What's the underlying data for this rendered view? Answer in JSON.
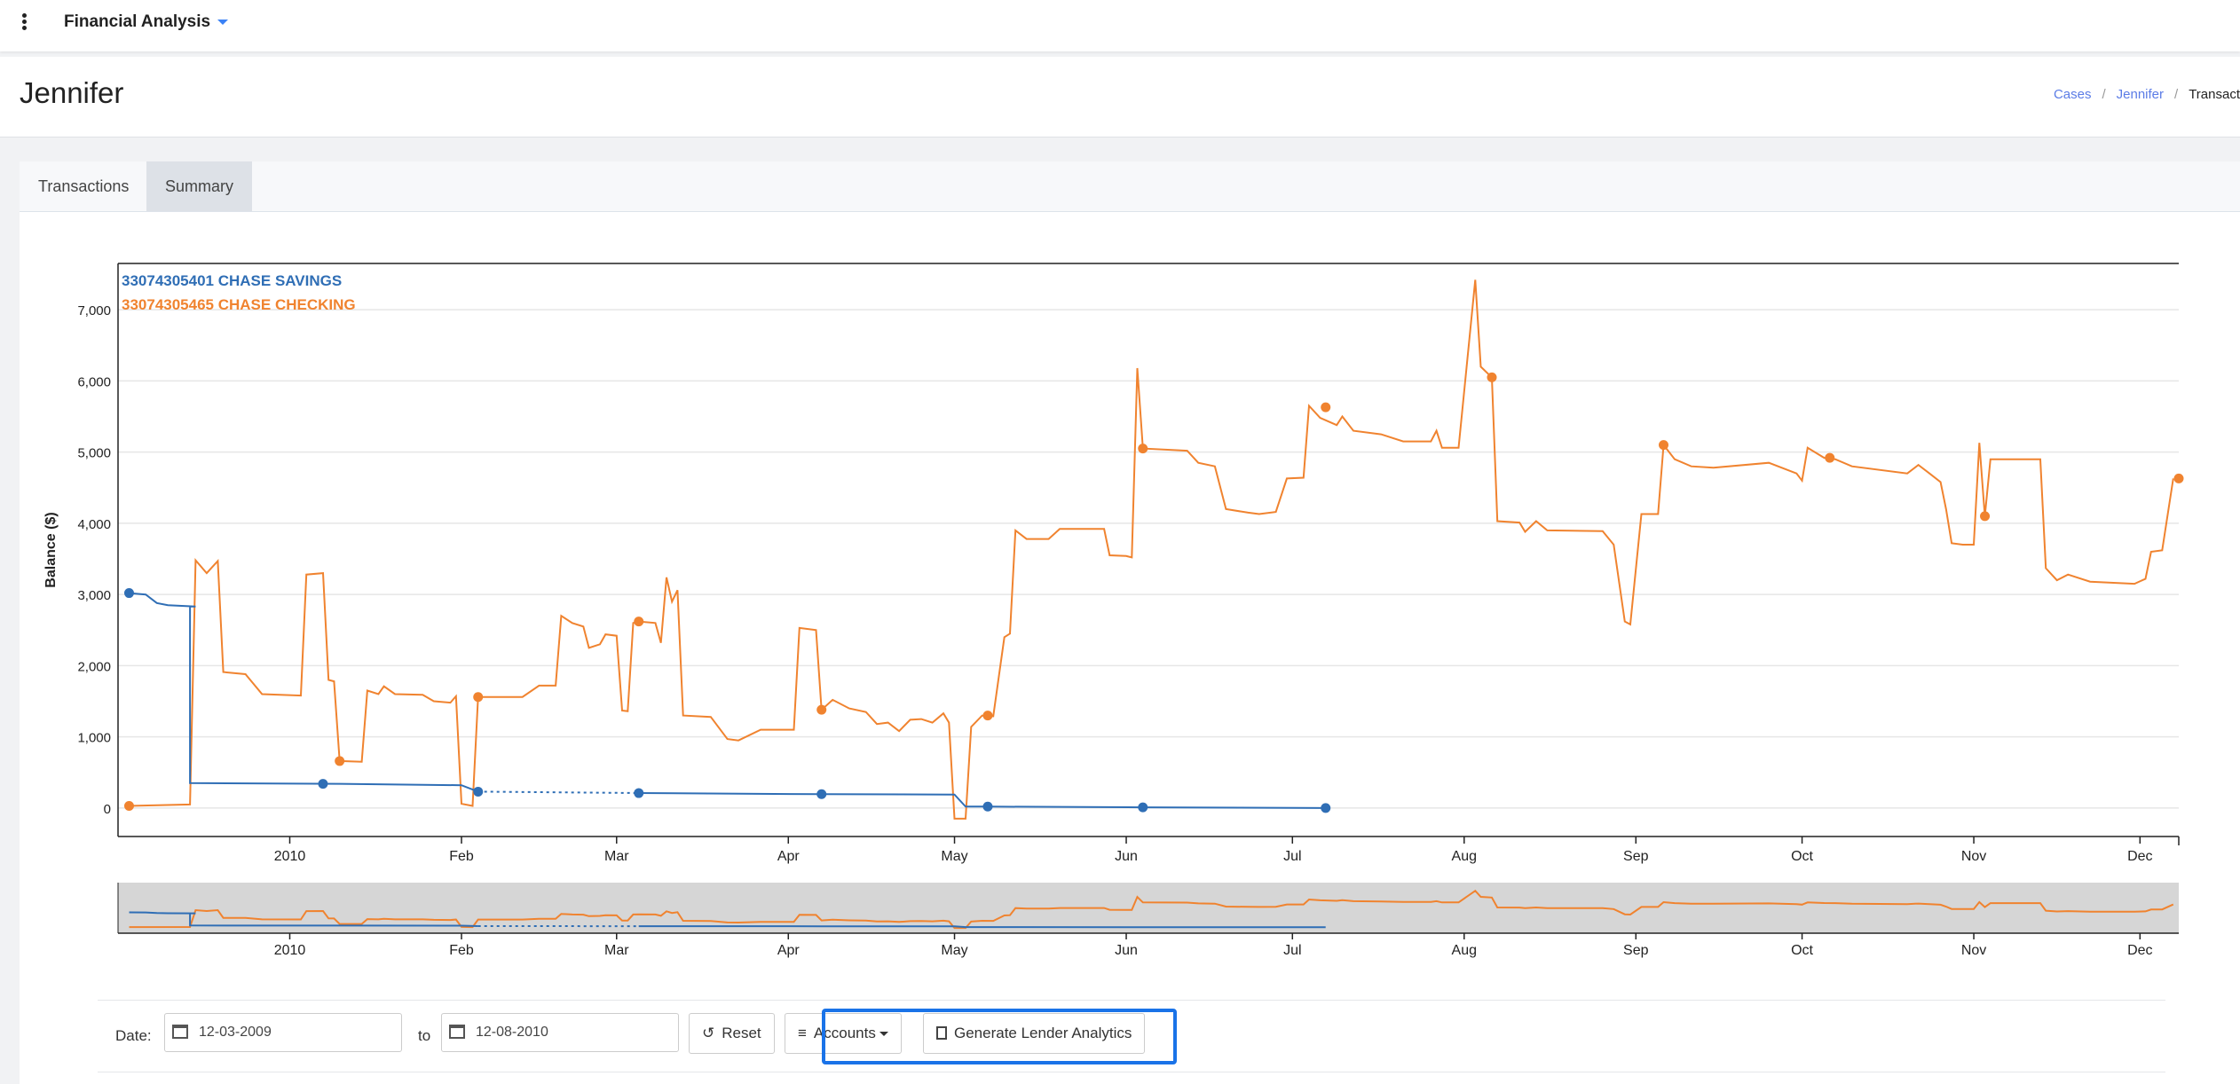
{
  "app": {
    "title": "Financial Analysis"
  },
  "page": {
    "title": "Jennifer"
  },
  "breadcrumb": {
    "items": [
      "Cases",
      "Jennifer"
    ],
    "current": "Transact"
  },
  "tabs": [
    {
      "label": "Transactions",
      "active": false
    },
    {
      "label": "Summary",
      "active": true
    }
  ],
  "controls": {
    "date_label": "Date:",
    "from_date": "12-03-2009",
    "to_label": "to",
    "to_date": "12-08-2010",
    "reset_label": "Reset",
    "accounts_label": "Accounts",
    "generate_label": "Generate Lender Analytics"
  },
  "colors": {
    "savings": "#2f6eb5",
    "checking": "#f0832f",
    "highlight": "#1a73e8",
    "link": "#5b7ce6"
  },
  "chart_data": {
    "type": "line",
    "title": "",
    "xlabel": "",
    "ylabel": "Balance ($)",
    "xlim": [
      "2009-12-01",
      "2010-12-08"
    ],
    "ylim": [
      -400,
      7650
    ],
    "yticks": [
      0,
      1000,
      2000,
      3000,
      4000,
      5000,
      6000,
      7000
    ],
    "ytick_labels": [
      "0",
      "1,000",
      "2,000",
      "3,000",
      "4,000",
      "5,000",
      "6,000",
      "7,000"
    ],
    "xticks": [
      {
        "date": "2010-01-01",
        "label": "2010"
      },
      {
        "date": "2010-02-01",
        "label": "Feb"
      },
      {
        "date": "2010-03-01",
        "label": "Mar"
      },
      {
        "date": "2010-04-01",
        "label": "Apr"
      },
      {
        "date": "2010-05-01",
        "label": "May"
      },
      {
        "date": "2010-06-01",
        "label": "Jun"
      },
      {
        "date": "2010-07-01",
        "label": "Jul"
      },
      {
        "date": "2010-08-01",
        "label": "Aug"
      },
      {
        "date": "2010-09-01",
        "label": "Sep"
      },
      {
        "date": "2010-10-01",
        "label": "Oct"
      },
      {
        "date": "2010-11-01",
        "label": "Nov"
      },
      {
        "date": "2010-12-01",
        "label": "Dec"
      }
    ],
    "grid": true,
    "legend": "top-left",
    "series": [
      {
        "name": "33074305401 CHASE SAVINGS",
        "color": "#2f6eb5",
        "points": [
          [
            "2009-12-03",
            3020
          ],
          [
            "2009-12-06",
            3000
          ],
          [
            "2009-12-08",
            2880
          ],
          [
            "2009-12-10",
            2850
          ],
          [
            "2009-12-15",
            2830
          ],
          [
            "2009-12-14",
            2830
          ],
          [
            "2009-12-14",
            350
          ],
          [
            "2010-01-10",
            340
          ],
          [
            "2010-02-01",
            320
          ],
          [
            "2010-02-04",
            230
          ]
        ],
        "dotted_points": [
          [
            "2010-02-04",
            230
          ],
          [
            "2010-03-05",
            210
          ]
        ],
        "points_after_gap": [
          [
            "2010-03-05",
            210
          ],
          [
            "2010-04-07",
            195
          ],
          [
            "2010-05-01",
            190
          ],
          [
            "2010-05-03",
            20
          ],
          [
            "2010-05-07",
            20
          ],
          [
            "2010-06-04",
            10
          ],
          [
            "2010-07-07",
            0
          ]
        ],
        "markers": [
          [
            "2009-12-03",
            3020
          ],
          [
            "2010-01-07",
            340
          ],
          [
            "2010-02-04",
            230
          ],
          [
            "2010-03-05",
            210
          ],
          [
            "2010-04-07",
            195
          ],
          [
            "2010-05-07",
            20
          ],
          [
            "2010-06-04",
            10
          ],
          [
            "2010-07-07",
            0
          ]
        ]
      },
      {
        "name": "33074305465 CHASE CHECKING",
        "color": "#f0832f",
        "points": [
          [
            "2009-12-03",
            30
          ],
          [
            "2009-12-14",
            50
          ],
          [
            "2009-12-15",
            3480
          ],
          [
            "2009-12-17",
            3300
          ],
          [
            "2009-12-19",
            3470
          ],
          [
            "2009-12-20",
            1910
          ],
          [
            "2009-12-24",
            1880
          ],
          [
            "2009-12-27",
            1600
          ],
          [
            "2010-01-03",
            1580
          ],
          [
            "2010-01-04",
            3280
          ],
          [
            "2010-01-07",
            3300
          ],
          [
            "2010-01-08",
            1800
          ],
          [
            "2010-01-09",
            1780
          ],
          [
            "2010-01-10",
            660
          ],
          [
            "2010-01-14",
            650
          ],
          [
            "2010-01-15",
            1650
          ],
          [
            "2010-01-17",
            1600
          ],
          [
            "2010-01-18",
            1710
          ],
          [
            "2010-01-20",
            1600
          ],
          [
            "2010-01-25",
            1590
          ],
          [
            "2010-01-27",
            1500
          ],
          [
            "2010-01-30",
            1480
          ],
          [
            "2010-01-31",
            1570
          ],
          [
            "2010-02-01",
            60
          ],
          [
            "2010-02-03",
            30
          ],
          [
            "2010-02-04",
            1560
          ],
          [
            "2010-02-12",
            1560
          ],
          [
            "2010-02-15",
            1720
          ],
          [
            "2010-02-18",
            1720
          ],
          [
            "2010-02-19",
            2700
          ],
          [
            "2010-02-21",
            2600
          ],
          [
            "2010-02-23",
            2550
          ],
          [
            "2010-02-24",
            2250
          ],
          [
            "2010-02-26",
            2300
          ],
          [
            "2010-02-27",
            2440
          ],
          [
            "2010-03-01",
            2420
          ],
          [
            "2010-03-02",
            1370
          ],
          [
            "2010-03-03",
            1360
          ],
          [
            "2010-03-04",
            2600
          ],
          [
            "2010-03-05",
            2620
          ],
          [
            "2010-03-08",
            2600
          ],
          [
            "2010-03-09",
            2320
          ],
          [
            "2010-03-10",
            3240
          ],
          [
            "2010-03-11",
            2900
          ],
          [
            "2010-03-12",
            3060
          ],
          [
            "2010-03-13",
            1300
          ],
          [
            "2010-03-18",
            1280
          ],
          [
            "2010-03-21",
            970
          ],
          [
            "2010-03-23",
            950
          ],
          [
            "2010-03-27",
            1100
          ],
          [
            "2010-04-02",
            1100
          ],
          [
            "2010-04-03",
            2530
          ],
          [
            "2010-04-06",
            2500
          ],
          [
            "2010-04-07",
            1380
          ],
          [
            "2010-04-09",
            1520
          ],
          [
            "2010-04-12",
            1400
          ],
          [
            "2010-04-15",
            1350
          ],
          [
            "2010-04-17",
            1180
          ],
          [
            "2010-04-19",
            1200
          ],
          [
            "2010-04-21",
            1080
          ],
          [
            "2010-04-23",
            1240
          ],
          [
            "2010-04-25",
            1250
          ],
          [
            "2010-04-27",
            1200
          ],
          [
            "2010-04-29",
            1330
          ],
          [
            "2010-04-30",
            1200
          ],
          [
            "2010-05-01",
            -150
          ],
          [
            "2010-05-03",
            -150
          ],
          [
            "2010-05-04",
            1140
          ],
          [
            "2010-05-06",
            1300
          ],
          [
            "2010-05-08",
            1290
          ],
          [
            "2010-05-10",
            2400
          ],
          [
            "2010-05-11",
            2450
          ],
          [
            "2010-05-12",
            3900
          ],
          [
            "2010-05-14",
            3780
          ],
          [
            "2010-05-18",
            3780
          ],
          [
            "2010-05-20",
            3920
          ],
          [
            "2010-05-28",
            3920
          ],
          [
            "2010-05-29",
            3550
          ],
          [
            "2010-06-01",
            3540
          ],
          [
            "2010-06-02",
            3520
          ],
          [
            "2010-06-03",
            6180
          ],
          [
            "2010-06-04",
            5050
          ],
          [
            "2010-06-12",
            5020
          ],
          [
            "2010-06-14",
            4850
          ],
          [
            "2010-06-17",
            4800
          ],
          [
            "2010-06-19",
            4200
          ],
          [
            "2010-06-23",
            4150
          ],
          [
            "2010-06-25",
            4130
          ],
          [
            "2010-06-28",
            4160
          ],
          [
            "2010-06-30",
            4630
          ],
          [
            "2010-07-03",
            4640
          ],
          [
            "2010-07-04",
            5650
          ],
          [
            "2010-07-06",
            5480
          ],
          [
            "2010-07-09",
            5380
          ],
          [
            "2010-07-10",
            5500
          ],
          [
            "2010-07-12",
            5300
          ],
          [
            "2010-07-17",
            5250
          ],
          [
            "2010-07-21",
            5150
          ],
          [
            "2010-07-26",
            5150
          ],
          [
            "2010-07-27",
            5300
          ],
          [
            "2010-07-28",
            5060
          ],
          [
            "2010-07-31",
            5060
          ],
          [
            "2010-08-03",
            7420
          ],
          [
            "2010-08-04",
            6200
          ],
          [
            "2010-08-06",
            6050
          ],
          [
            "2010-08-07",
            4030
          ],
          [
            "2010-08-11",
            4010
          ],
          [
            "2010-08-12",
            3880
          ],
          [
            "2010-08-14",
            4030
          ],
          [
            "2010-08-16",
            3900
          ],
          [
            "2010-08-26",
            3890
          ],
          [
            "2010-08-28",
            3700
          ],
          [
            "2010-08-30",
            2620
          ],
          [
            "2010-08-31",
            2580
          ],
          [
            "2010-09-02",
            4130
          ],
          [
            "2010-09-05",
            4130
          ],
          [
            "2010-09-06",
            5100
          ],
          [
            "2010-09-08",
            4900
          ],
          [
            "2010-09-11",
            4800
          ],
          [
            "2010-09-15",
            4780
          ],
          [
            "2010-09-25",
            4850
          ],
          [
            "2010-09-30",
            4700
          ],
          [
            "2010-10-01",
            4600
          ],
          [
            "2010-10-02",
            5060
          ],
          [
            "2010-10-05",
            4920
          ],
          [
            "2010-10-07",
            4900
          ],
          [
            "2010-10-10",
            4800
          ],
          [
            "2010-10-20",
            4700
          ],
          [
            "2010-10-22",
            4820
          ],
          [
            "2010-10-24",
            4700
          ],
          [
            "2010-10-26",
            4580
          ],
          [
            "2010-10-27",
            4200
          ],
          [
            "2010-10-28",
            3720
          ],
          [
            "2010-10-30",
            3700
          ],
          [
            "2010-11-01",
            3700
          ],
          [
            "2010-11-02",
            5130
          ],
          [
            "2010-11-03",
            4100
          ],
          [
            "2010-11-04",
            4900
          ],
          [
            "2010-11-13",
            4900
          ],
          [
            "2010-11-14",
            3370
          ],
          [
            "2010-11-16",
            3200
          ],
          [
            "2010-11-18",
            3280
          ],
          [
            "2010-11-22",
            3180
          ],
          [
            "2010-11-30",
            3150
          ],
          [
            "2010-12-02",
            3220
          ],
          [
            "2010-12-03",
            3600
          ],
          [
            "2010-12-05",
            3620
          ],
          [
            "2010-12-07",
            4630
          ]
        ],
        "markers": [
          [
            "2009-12-03",
            30
          ],
          [
            "2010-01-10",
            660
          ],
          [
            "2010-02-04",
            1560
          ],
          [
            "2010-03-05",
            2620
          ],
          [
            "2010-04-07",
            1380
          ],
          [
            "2010-05-07",
            1300
          ],
          [
            "2010-06-04",
            5050
          ],
          [
            "2010-07-07",
            5630
          ],
          [
            "2010-08-06",
            6050
          ],
          [
            "2010-09-06",
            5100
          ],
          [
            "2010-10-06",
            4920
          ],
          [
            "2010-11-03",
            4100
          ],
          [
            "2010-12-08",
            4630
          ]
        ]
      }
    ]
  }
}
